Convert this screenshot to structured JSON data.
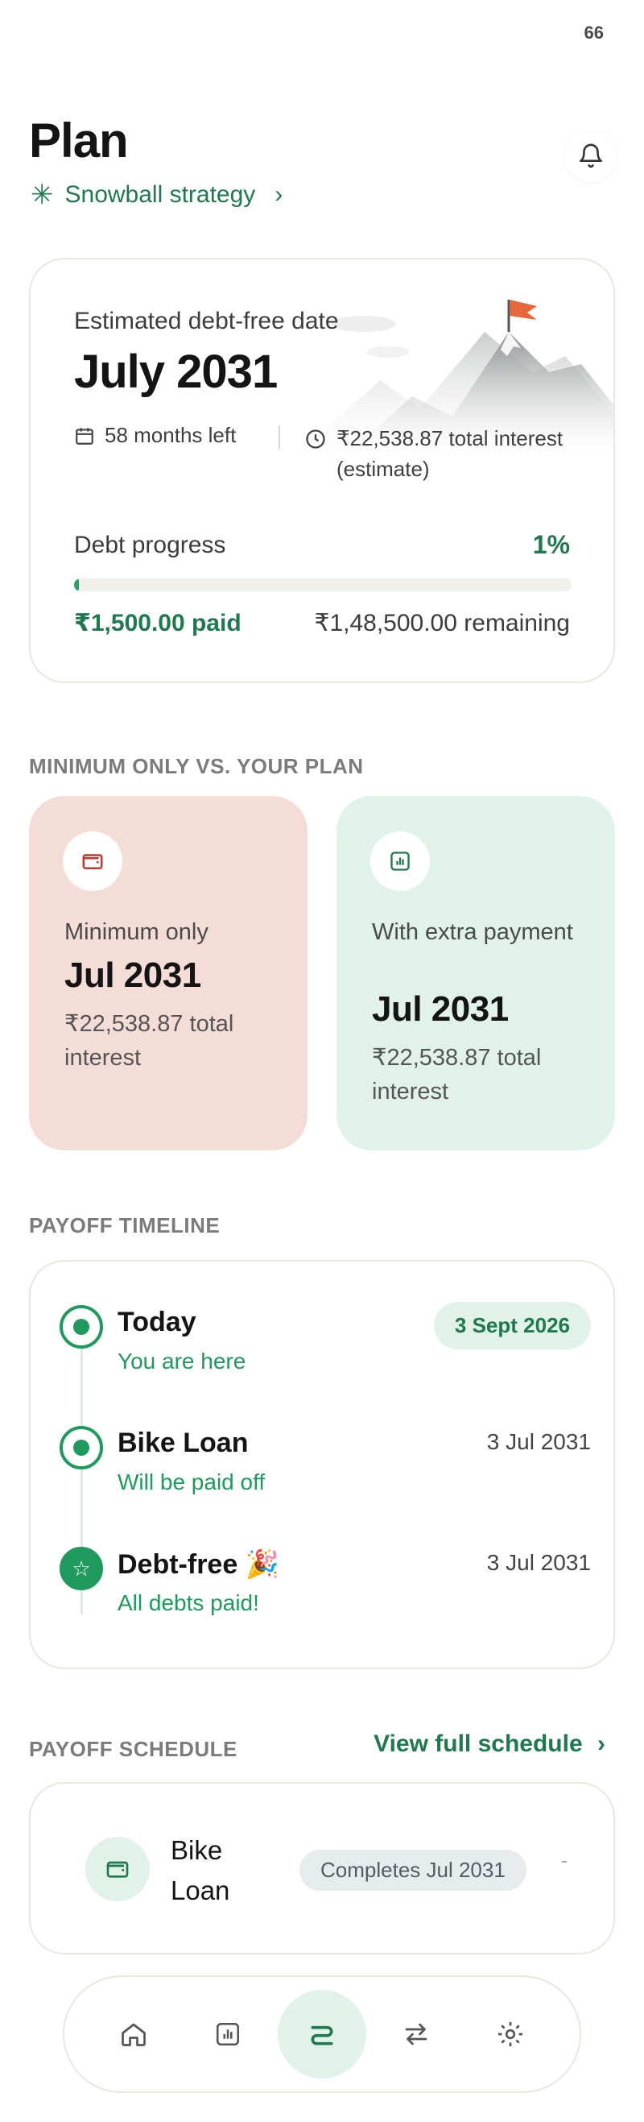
{
  "status_bar": {
    "time": "66"
  },
  "header": {
    "title": "Plan",
    "strategy": "Snowball strategy"
  },
  "hero": {
    "label": "Estimated debt-free date",
    "date": "July 2031",
    "months_left": "58 months left",
    "interest": "₹22,538.87 total interest (estimate)",
    "progress_label": "Debt progress",
    "progress_percent_text": "1%",
    "progress_fraction": 0.01,
    "paid": "₹1,500.00 paid",
    "remaining": "₹1,48,500.00 remaining"
  },
  "comparison": {
    "heading": "MINIMUM ONLY VS. YOUR PLAN",
    "minimum": {
      "label": "Minimum only",
      "date": "Jul 2031",
      "interest": "₹22,538.87 total interest",
      "icon": "wallet-icon"
    },
    "extra": {
      "label": "With extra payment",
      "date": "Jul 2031",
      "interest": "₹22,538.87 total interest",
      "icon": "chart-icon"
    }
  },
  "timeline": {
    "heading": "PAYOFF TIMELINE",
    "items": [
      {
        "title": "Today",
        "subtitle": "You are here",
        "date": "3 Sept 2026"
      },
      {
        "title": "Bike Loan",
        "subtitle": "Will be paid off",
        "date": "3 Jul 2031"
      },
      {
        "title": "Debt-free 🎉",
        "subtitle": "All debts paid!",
        "date": "3 Jul 2031"
      }
    ]
  },
  "schedule": {
    "heading": "PAYOFF SCHEDULE",
    "view_all": "View full schedule",
    "item": {
      "name": "Bike Loan",
      "status": "Completes Jul 2031"
    }
  },
  "nav": {
    "items": [
      "home-icon",
      "chart-icon",
      "plan-icon",
      "transfer-icon",
      "settings-icon"
    ],
    "active": "plan-icon"
  },
  "colors": {
    "accent": "#1e7a4e",
    "accent_light": "#e1f3e9",
    "minimum_card": "#f4ddd7",
    "flag": "#e8673a"
  }
}
